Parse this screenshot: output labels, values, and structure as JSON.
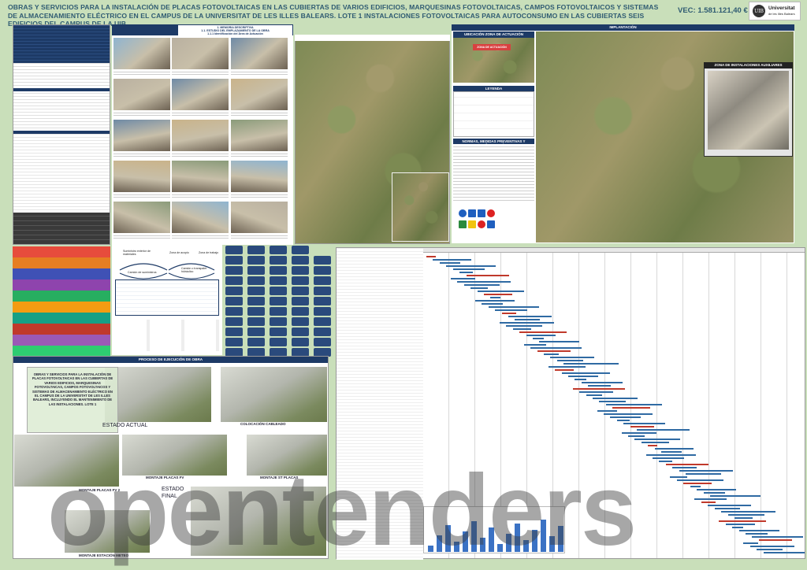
{
  "header": {
    "title": "Obras y servicios para la instalación de placas fotovoltaicas en las cubiertas de varios edificios, marquesinas fotovoltaicas, campos fotovoltaicos y sistemas de almacenamiento eléctrico en el campus de la Universitat de les Illes Balears. Lote 1 Instalaciones fotovoltaicas para autoconsumo en las cubiertas seis edificios del campus de la UIB",
    "vec": "VEC: 1.581.121,40 €",
    "logo_name": "Universitat",
    "logo_sub": "de les Illes Balears",
    "logo_mark": "UIB"
  },
  "sections": {
    "memoria": "1. MEMORIA DESCRIPTIVA",
    "estudio": "1.1. ESTUDIO DEL EMPLAZAMIENTO DE LA OBRA",
    "identificacion": "1.1.1 Identificación del Área de Actuación",
    "implantacion": "IMPLANTACIÓN",
    "ubicacion": "UBICACIÓN ZONA DE ACTUACIÓN",
    "leyenda": "LEYENDA",
    "normas": "NORMAS, MEDIDAS PREVENTIVAS Y SEÑALIZACIÓN",
    "zona_aux": "ZONA DE INSTALACIONES AUXILIARES",
    "proceso": "PROCESO DE EJECUCIÓN DE OBRA",
    "zona_actuacion": "ZONA DE ACTUACIÓN"
  },
  "diagram": {
    "suministro": "Suministro exterior de materiales",
    "zona_acopio": "Zona de acopio",
    "zona_trabajo": "Zona de trabajo",
    "camion": "Camión de suministros",
    "camion_grua": "Camión o transpalet hidráulico"
  },
  "renders": {
    "box_text": "OBRAS Y SERVICIOS PARA LA INSTALACIÓN DE PLACAS FOTOVOLTAICAS EN LAS CUBIERTAS DE VARIOS EDIFICIOS, MARQUESINAS FOTOVOLTAICAS, CAMPOS FOTOVOLTAICOS Y SISTEMAS DE ALMACENAMIENTO ELÉCTRICO EN EL CAMPUS DE LA UNIVERSITAT DE LES ILLES BALEARS, INCLUYENDO EL MANTENIMIENTO DE LAS INSTALACIONES. LOTE 1",
    "estado_actual": "ESTADO ACTUAL",
    "colocacion": "COLOCACIÓN CABLEADO",
    "placas_fv": "MONTAJE PLACAS FV",
    "placas_fv2": "MONTAJE PLACAS FV 2",
    "st_placas": "MONTAJE ST PLACAS",
    "estado_final": "ESTADO FINAL",
    "meteo": "MONTAJE ESTACIÓN METEO"
  },
  "watermark": "opentenders",
  "colors": {
    "background": "#c9dfba",
    "navy": "#1d3a66",
    "title": "#2f5b72",
    "phases": [
      "#e74c3c",
      "#e67e22",
      "#3f51b5",
      "#8e44ad",
      "#27ae60",
      "#f39c12",
      "#16a085",
      "#c0392b",
      "#9b59b6",
      "#2ecc71"
    ]
  }
}
